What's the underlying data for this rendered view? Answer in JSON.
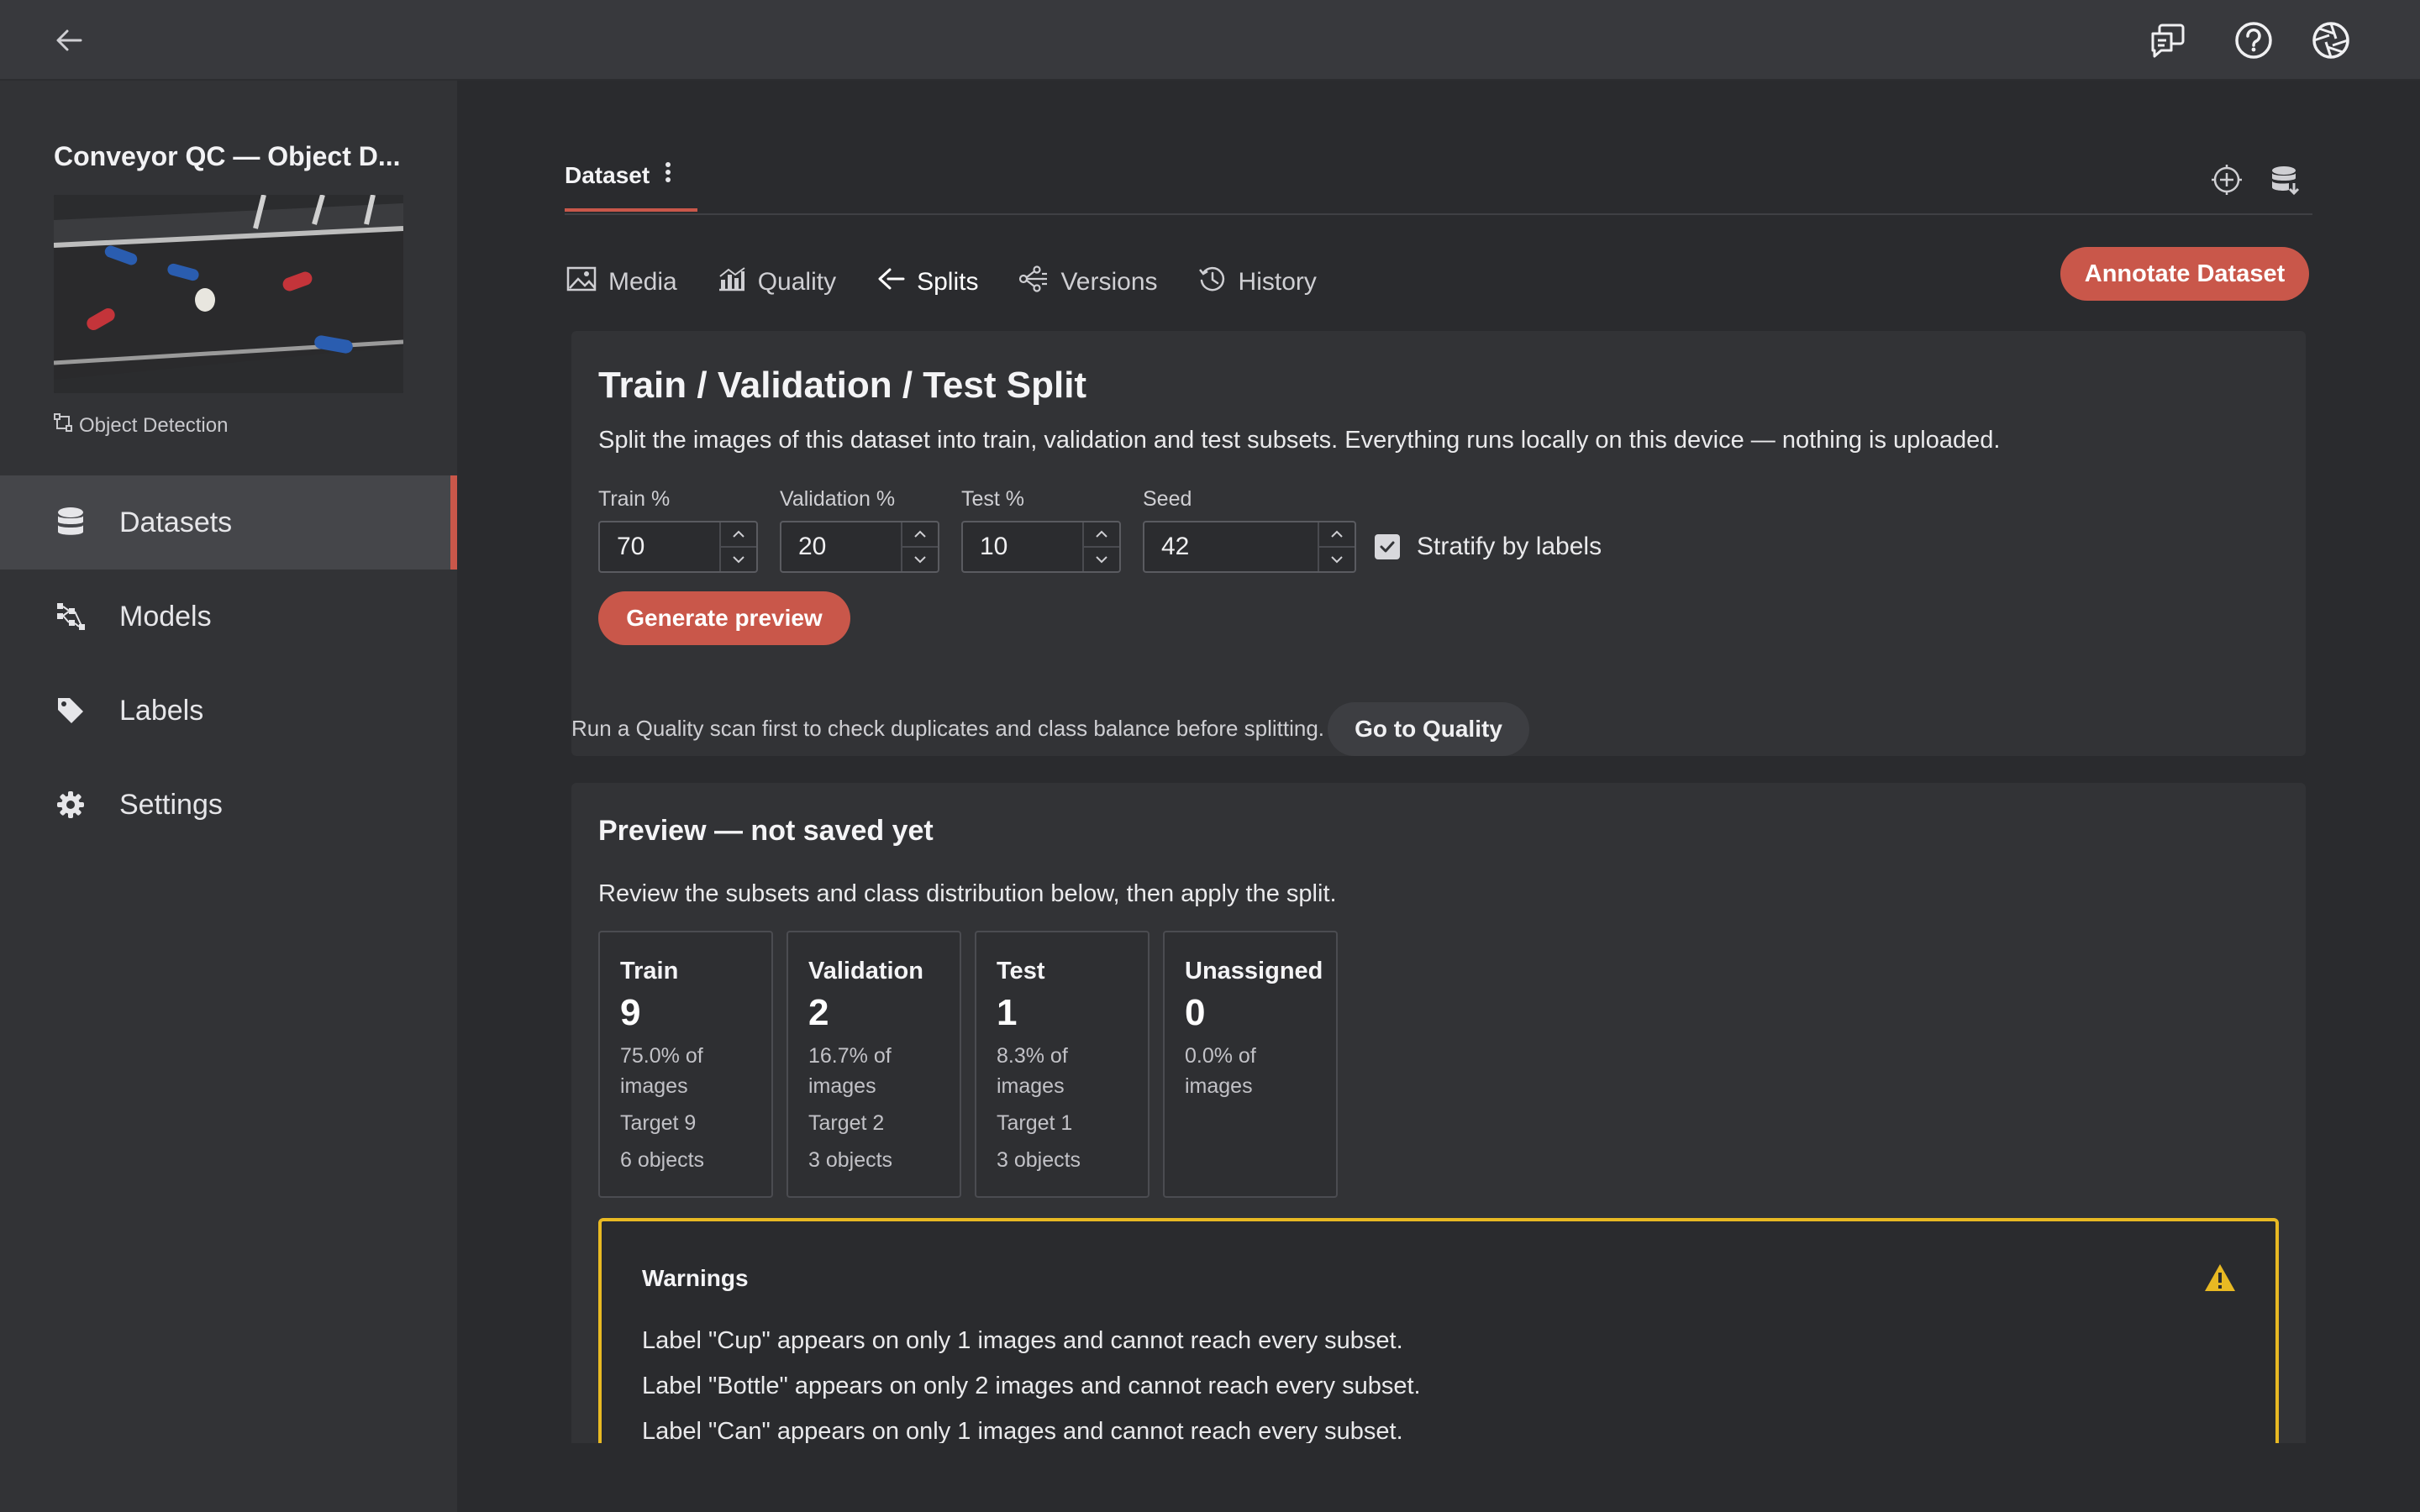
{
  "topbar": {
    "back_icon": "arrow-left-icon",
    "icons": [
      "feedback-icon",
      "help-icon",
      "aperture-icon"
    ]
  },
  "sidebar": {
    "project_title": "Conveyor QC — Object D...",
    "project_type": "Object Detection",
    "items": [
      {
        "label": "Datasets",
        "icon": "database-icon",
        "active": true
      },
      {
        "label": "Models",
        "icon": "models-icon",
        "active": false
      },
      {
        "label": "Labels",
        "icon": "tag-icon",
        "active": false
      },
      {
        "label": "Settings",
        "icon": "gear-icon",
        "active": false
      }
    ]
  },
  "main": {
    "dataset_tab": "Dataset",
    "subtabs": [
      {
        "label": "Media",
        "icon": "image-icon"
      },
      {
        "label": "Quality",
        "icon": "chart-icon"
      },
      {
        "label": "Splits",
        "icon": "split-icon",
        "active": true
      },
      {
        "label": "Versions",
        "icon": "versions-icon"
      },
      {
        "label": "History",
        "icon": "history-icon"
      }
    ],
    "annotate_label": "Annotate Dataset"
  },
  "split": {
    "title": "Train / Validation / Test Split",
    "description": "Split the images of this dataset into train, validation and test subsets. Everything runs locally on this device — nothing is uploaded.",
    "fields": {
      "train": {
        "label": "Train %",
        "value": "70"
      },
      "validation": {
        "label": "Validation %",
        "value": "20"
      },
      "test": {
        "label": "Test %",
        "value": "10"
      },
      "seed": {
        "label": "Seed",
        "value": "42"
      }
    },
    "stratify_label": "Stratify by labels",
    "stratify_checked": true,
    "generate_label": "Generate preview"
  },
  "hint": {
    "text": "Run a Quality scan first to check duplicates and class balance before splitting.",
    "button": "Go to Quality"
  },
  "preview": {
    "title": "Preview — not saved yet",
    "description": "Review the subsets and class distribution below, then apply the split.",
    "subsets": [
      {
        "name": "Train",
        "count": "9",
        "pct": "75.0% of",
        "pct2": "images",
        "target": "Target 9",
        "objects": "6 objects"
      },
      {
        "name": "Validation",
        "count": "2",
        "pct": "16.7% of",
        "pct2": "images",
        "target": "Target 2",
        "objects": "3 objects"
      },
      {
        "name": "Test",
        "count": "1",
        "pct": "8.3% of",
        "pct2": "images",
        "target": "Target 1",
        "objects": "3 objects"
      },
      {
        "name": "Unassigned",
        "count": "0",
        "pct": "0.0% of",
        "pct2": "images"
      }
    ],
    "warnings": {
      "title": "Warnings",
      "lines": [
        "Label \"Cup\" appears on only 1 images and cannot reach every subset.",
        "Label \"Bottle\" appears on only 2 images and cannot reach every subset.",
        "Label \"Can\" appears on only 1 images and cannot reach every subset."
      ]
    }
  },
  "colors": {
    "accent": "#c9574a",
    "warning": "#e8b923"
  }
}
